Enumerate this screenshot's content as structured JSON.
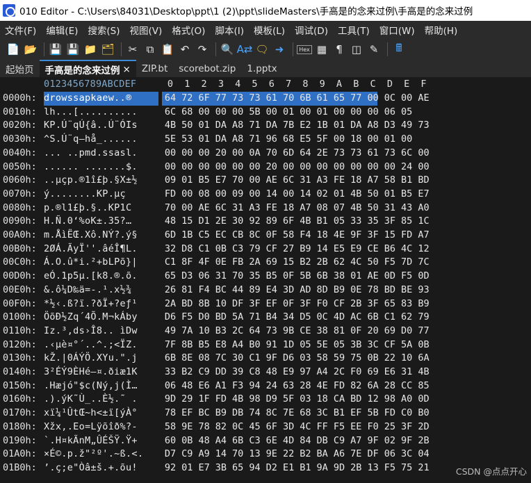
{
  "window": {
    "title": "010 Editor - C:\\Users\\84031\\Desktop\\ppt\\1 (2)\\ppt\\slideMasters\\手高是的念来过例\\手高是的念来过例"
  },
  "menu": [
    "文件(F)",
    "编辑(E)",
    "搜索(S)",
    "视图(V)",
    "格式(O)",
    "脚本(I)",
    "模板(L)",
    "调试(D)",
    "工具(T)",
    "窗口(W)",
    "帮助(H)"
  ],
  "toolbar": {
    "icons": [
      "new-file",
      "open-folder",
      "save",
      "save-all",
      "folder",
      "folders",
      "cut",
      "copy",
      "paste",
      "undo",
      "redo",
      "find",
      "replace",
      "find-in-files",
      "goto",
      "hex-mode",
      "toggle",
      "pilcrow",
      "columns",
      "highlight",
      "calculator"
    ],
    "hex_label": "Hex"
  },
  "tabs": [
    {
      "label": "起始页",
      "active": false
    },
    {
      "label": "手高是的念来过例",
      "active": true,
      "close": "×"
    },
    {
      "label": "ZIP.bt",
      "active": false
    },
    {
      "label": "scorebot.zip",
      "active": false
    },
    {
      "label": "1.pptx",
      "active": false
    }
  ],
  "header": {
    "ascii_ruler": "0123456789ABCDEF",
    "hex_columns": [
      "0",
      "1",
      "2",
      "3",
      "4",
      "5",
      "6",
      "7",
      "8",
      "9",
      "A",
      "B",
      "C",
      "D",
      "E",
      "F"
    ]
  },
  "rows": [
    {
      "addr": "0000h:",
      "ascii": "drowssapkaew..®",
      "hex": [
        "64",
        "72",
        "6F",
        "77",
        "73",
        "73",
        "61",
        "70",
        "6B",
        "61",
        "65",
        "77",
        "00",
        "0C",
        "00",
        "AE"
      ],
      "selected": 13
    },
    {
      "addr": "0010h:",
      "ascii": "lh...[..........",
      "hex": [
        "6C",
        "68",
        "00",
        "00",
        "00",
        "5B",
        "00",
        "01",
        "00",
        "01",
        "00",
        "00",
        "00",
        "06",
        "05"
      ]
    },
    {
      "addr": "0020h:",
      "ascii": "KP.Ú¨qÚ{â..Ú¨ÓIs",
      "hex": [
        "4B",
        "50",
        "01",
        "DA",
        "A8",
        "71",
        "DA",
        "7B",
        "E2",
        "1B",
        "01",
        "DA",
        "A8",
        "D3",
        "49",
        "73"
      ]
    },
    {
      "addr": "0030h:",
      "ascii": "^S.Ú¨q–hå_......",
      "hex": [
        "5E",
        "53",
        "01",
        "DA",
        "A8",
        "71",
        "96",
        "68",
        "E5",
        "5F",
        "00",
        "18",
        "00",
        "01",
        "00"
      ]
    },
    {
      "addr": "0040h:",
      "ascii": "... ..pmd.ssasl.",
      "hex": [
        "00",
        "00",
        "00",
        "20",
        "00",
        "0A",
        "70",
        "6D",
        "64",
        "2E",
        "73",
        "73",
        "61",
        "73",
        "6C",
        "00"
      ]
    },
    {
      "addr": "0050h:",
      "ascii": "...... .......$.",
      "hex": [
        "00",
        "00",
        "00",
        "00",
        "00",
        "00",
        "20",
        "00",
        "00",
        "00",
        "00",
        "00",
        "00",
        "00",
        "24",
        "00"
      ]
    },
    {
      "addr": "0060h:",
      "ascii": "..µçp.®1î£þ.§X±½",
      "hex": [
        "09",
        "01",
        "B5",
        "E7",
        "70",
        "00",
        "AE",
        "6C",
        "31",
        "A3",
        "FE",
        "18",
        "A7",
        "58",
        "B1",
        "BD"
      ]
    },
    {
      "addr": "0070h:",
      "ascii": "ý........KP.µç",
      "hex": [
        "FD",
        "00",
        "08",
        "00",
        "09",
        "00",
        "14",
        "00",
        "14",
        "02",
        "01",
        "4B",
        "50",
        "01",
        "B5",
        "E7"
      ]
    },
    {
      "addr": "0080h:",
      "ascii": "p.®l1£þ.§..KP1C",
      "hex": [
        "70",
        "00",
        "AE",
        "6C",
        "31",
        "A3",
        "FE",
        "18",
        "A7",
        "08",
        "07",
        "4B",
        "50",
        "31",
        "43",
        "A0"
      ]
    },
    {
      "addr": "0090h:",
      "ascii": "H.Ñ.0‘%oK±.35?…",
      "hex": [
        "48",
        "15",
        "D1",
        "2E",
        "30",
        "92",
        "89",
        "6F",
        "4B",
        "B1",
        "05",
        "33",
        "35",
        "3F",
        "85",
        "1C"
      ]
    },
    {
      "addr": "00A0h:",
      "ascii": "m.ÅìËŒ.Xô.NÝ?.ý§",
      "hex": [
        "6D",
        "1B",
        "C5",
        "EC",
        "CB",
        "8C",
        "0F",
        "58",
        "F4",
        "18",
        "4E",
        "9F",
        "3F",
        "15",
        "FD",
        "A7"
      ]
    },
    {
      "addr": "00B0h:",
      "ascii": "2ØÁ.ÃyÏ''.âéÎ¶L.",
      "hex": [
        "32",
        "D8",
        "C1",
        "0B",
        "C3",
        "79",
        "CF",
        "27",
        "B9",
        "14",
        "E5",
        "E9",
        "CE",
        "B6",
        "4C",
        "12"
      ]
    },
    {
      "addr": "00C0h:",
      "ascii": "Á.O.û*i.²+bLPõ}|",
      "hex": [
        "C1",
        "8F",
        "4F",
        "0E",
        "FB",
        "2A",
        "69",
        "15",
        "B2",
        "2B",
        "62",
        "4C",
        "50",
        "F5",
        "7D",
        "7C"
      ]
    },
    {
      "addr": "00D0h:",
      "ascii": "eÓ.1p5µ.[k8.®.õ.",
      "hex": [
        "65",
        "D3",
        "06",
        "31",
        "70",
        "35",
        "B5",
        "0F",
        "5B",
        "6B",
        "38",
        "01",
        "AE",
        "0D",
        "F5",
        "0D"
      ]
    },
    {
      "addr": "00E0h:",
      "ascii": "&.ô¼D‰ä=-.¹.x½¾",
      "hex": [
        "26",
        "81",
        "F4",
        "BC",
        "44",
        "89",
        "E4",
        "3D",
        "AD",
        "8D",
        "B9",
        "0E",
        "78",
        "BD",
        "BE",
        "93"
      ]
    },
    {
      "addr": "00F0h:",
      "ascii": "*½‹.ß?ï.?ðÏ+?eƒ¹",
      "hex": [
        "2A",
        "BD",
        "8B",
        "10",
        "DF",
        "3F",
        "EF",
        "0F",
        "3F",
        "F0",
        "CF",
        "2B",
        "3F",
        "65",
        "83",
        "B9"
      ]
    },
    {
      "addr": "0100h:",
      "ascii": "ÖõÐ½Zq´4Õ.M¬kÁby",
      "hex": [
        "D6",
        "F5",
        "D0",
        "BD",
        "5A",
        "71",
        "B4",
        "34",
        "D5",
        "0C",
        "4D",
        "AC",
        "6B",
        "C1",
        "62",
        "79"
      ]
    },
    {
      "addr": "0110h:",
      "ascii": "Iz.³,ds›Î8.. ìDw",
      "hex": [
        "49",
        "7A",
        "10",
        "B3",
        "2C",
        "64",
        "73",
        "9B",
        "CE",
        "38",
        "81",
        "0F",
        "20",
        "69",
        "D0",
        "77"
      ]
    },
    {
      "addr": "0120h:",
      "ascii": ".‹µè¤°´..^.;<ÏZ.",
      "hex": [
        "7F",
        "8B",
        "B5",
        "E8",
        "A4",
        "B0",
        "91",
        "1D",
        "05",
        "5E",
        "05",
        "3B",
        "3C",
        "CF",
        "5A",
        "0B"
      ]
    },
    {
      "addr": "0130h:",
      "ascii": "kŽ.|0ÁÝÖ.XYu.\".j",
      "hex": [
        "6B",
        "8E",
        "08",
        "7C",
        "30",
        "C1",
        "9F",
        "D6",
        "03",
        "58",
        "59",
        "75",
        "0B",
        "22",
        "10",
        "6A"
      ]
    },
    {
      "addr": "0140h:",
      "ascii": "3²ÉÝ9ÈHé–¤.ðiæ1K",
      "hex": [
        "33",
        "B2",
        "C9",
        "DD",
        "39",
        "C8",
        "48",
        "E9",
        "97",
        "A4",
        "2C",
        "F0",
        "69",
        "E6",
        "31",
        "4B"
      ]
    },
    {
      "addr": "0150h:",
      "ascii": ".Hæjó\"$c(Ný,j(Ì…",
      "hex": [
        "06",
        "48",
        "E6",
        "A1",
        "F3",
        "94",
        "24",
        "63",
        "28",
        "4E",
        "FD",
        "82",
        "6A",
        "28",
        "CC",
        "85"
      ]
    },
    {
      "addr": "0160h:",
      "ascii": ".).ýK˜Ù_..È½.˜ .",
      "hex": [
        "9D",
        "29",
        "1F",
        "FD",
        "4B",
        "98",
        "D9",
        "5F",
        "03",
        "18",
        "CA",
        "BD",
        "12",
        "98",
        "A0",
        "0D"
      ]
    },
    {
      "addr": "0170h:",
      "ascii": "xï¼¹ÛtŒ~h<±ï[ýÀ°",
      "hex": [
        "78",
        "EF",
        "BC",
        "B9",
        "DB",
        "74",
        "8C",
        "7E",
        "68",
        "3C",
        "B1",
        "EF",
        "5B",
        "FD",
        "C0",
        "B0"
      ]
    },
    {
      "addr": "0180h:",
      "ascii": "Xžx,.Eo=Lÿõîð%?-",
      "hex": [
        "58",
        "9E",
        "78",
        "82",
        "0C",
        "45",
        "6F",
        "3D",
        "4C",
        "FF",
        "F5",
        "EE",
        "F0",
        "25",
        "3F",
        "2D"
      ]
    },
    {
      "addr": "0190h:",
      "ascii": "`.H¤kÃnM„ÛÉŠŸ.Ÿ+",
      "hex": [
        "60",
        "0B",
        "48",
        "A4",
        "6B",
        "C3",
        "6E",
        "4D",
        "84",
        "DB",
        "C9",
        "A7",
        "9F",
        "02",
        "9F",
        "2B"
      ]
    },
    {
      "addr": "01A0h:",
      "ascii": "×É©.p.ž\"²º'.~ß.<.",
      "hex": [
        "D7",
        "C9",
        "A9",
        "14",
        "70",
        "13",
        "9E",
        "22",
        "B2",
        "BA",
        "A6",
        "7E",
        "DF",
        "06",
        "3C",
        "04"
      ]
    },
    {
      "addr": "01B0h:",
      "ascii": "’.ç;e\"Òâ±š.+.õu!",
      "hex": [
        "92",
        "01",
        "E7",
        "3B",
        "65",
        "94",
        "D2",
        "E1",
        "B1",
        "9A",
        "9D",
        "2B",
        "13",
        "F5",
        "75",
        "21"
      ]
    }
  ],
  "watermark": "CSDN @点点开心"
}
